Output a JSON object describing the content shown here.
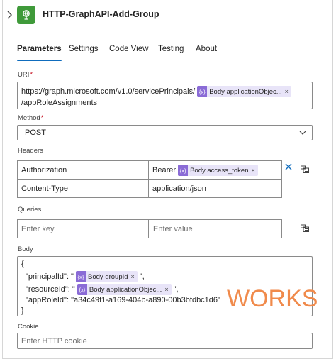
{
  "header": {
    "title": "HTTP-GraphAPI-Add-Group",
    "icon": "http-globe-icon"
  },
  "tabs": [
    {
      "label": "Parameters",
      "active": true
    },
    {
      "label": "Settings",
      "active": false
    },
    {
      "label": "Code View",
      "active": false
    },
    {
      "label": "Testing",
      "active": false
    },
    {
      "label": "About",
      "active": false
    }
  ],
  "uri": {
    "label": "URI",
    "required": "*",
    "line1_prefix": "https://graph.microsoft.com/v1.0/servicePrincipals/",
    "token": "Body applicationObjec...",
    "line2": "/appRoleAssignments"
  },
  "method": {
    "label": "Method",
    "required": "*",
    "value": "POST"
  },
  "headers": {
    "label": "Headers",
    "rows": [
      {
        "key": "Authorization",
        "value_prefix": "Bearer",
        "token": "Body access_token"
      },
      {
        "key": "Content-Type",
        "value": "application/json"
      }
    ]
  },
  "queries": {
    "label": "Queries",
    "key_placeholder": "Enter key",
    "value_placeholder": "Enter value"
  },
  "body": {
    "label": "Body",
    "open_brace": "{",
    "line1_key": "\"principalId\": \"",
    "line1_token": "Body groupId",
    "line1_end": "\",",
    "line2_key": "\"resourceId\": \"",
    "line2_token": "Body applicationObjec...",
    "line2_end": "\",",
    "line3": "\"appRoleId\": \"a34c49f1-a169-404b-a890-00b3bfdbc1d6\"",
    "close_brace": "}"
  },
  "cookie": {
    "label": "Cookie",
    "placeholder": "Enter HTTP cookie"
  },
  "annotation": {
    "text": "WORKS",
    "color": "#f08a4b"
  },
  "token_icon_text": "{x}",
  "token_remove": "×",
  "colors": {
    "accent": "#0f6cbd",
    "app_icon": "#3f9a3a",
    "token_bg": "#e8e4f8",
    "token_icon": "#8a6bd6"
  }
}
